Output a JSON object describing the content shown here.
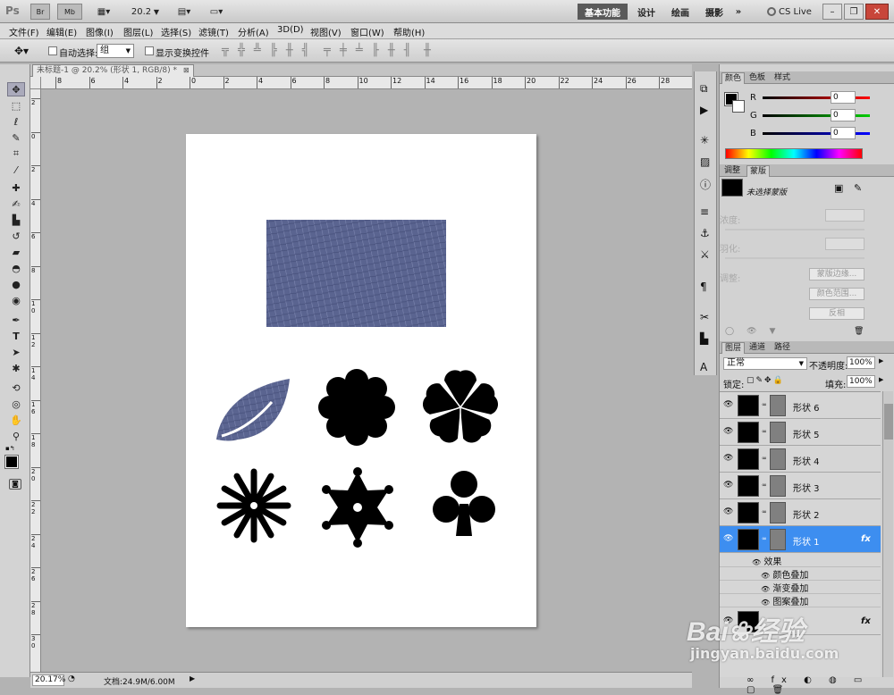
{
  "app": {
    "logo": "Ps",
    "zoom": "20.2",
    "workspace_active": "基本功能",
    "workspaces": [
      "设计",
      "绘画",
      "摄影"
    ],
    "cs_live": "CS Live"
  },
  "menu": [
    "文件(F)",
    "编辑(E)",
    "图像(I)",
    "图层(L)",
    "选择(S)",
    "滤镜(T)",
    "分析(A)",
    "3D(D)",
    "视图(V)",
    "窗口(W)",
    "帮助(H)"
  ],
  "options": {
    "auto_select_label": "自动选择:",
    "auto_select_value": "组",
    "transform_label": "显示变换控件"
  },
  "document": {
    "tab_title": "未标题-1 @ 20.2% (形状 1, RGB/8) *"
  },
  "ruler": {
    "h_labels": [
      "8",
      "6",
      "4",
      "2",
      "0",
      "2",
      "4",
      "6",
      "8",
      "10",
      "12",
      "14",
      "16",
      "18",
      "20",
      "22",
      "24",
      "26",
      "28"
    ],
    "v_labels": [
      "2",
      "0",
      "2",
      "4",
      "6",
      "8",
      "1\n0",
      "1\n2",
      "1\n4",
      "1\n6",
      "1\n8",
      "2\n0",
      "2\n2",
      "2\n4",
      "2\n6",
      "2\n8",
      "3\n0"
    ]
  },
  "status": {
    "zoom": "20.17%",
    "doc": "文档:24.9M/6.00M"
  },
  "color_panel": {
    "tabs": [
      "颜色",
      "色板",
      "样式"
    ],
    "r_label": "R",
    "g_label": "G",
    "b_label": "B",
    "r": "0",
    "g": "0",
    "b": "0"
  },
  "adjust_panel": {
    "tabs": [
      "调整",
      "蒙版"
    ],
    "no_mask": "未选择蒙版",
    "density": "浓度:",
    "feather": "羽化:",
    "adjust": "调整:",
    "edge_btn": "蒙版边缘...",
    "range_btn": "颜色范围...",
    "invert_btn": "反相"
  },
  "layers_panel": {
    "tabs": [
      "图层",
      "通道",
      "路径"
    ],
    "blend_mode": "正常",
    "opacity_label": "不透明度:",
    "opacity": "100%",
    "lock_label": "锁定:",
    "fill_label": "填充:",
    "fill": "100%",
    "layers": [
      "形状 6",
      "形状 5",
      "形状 4",
      "形状 3",
      "形状 2",
      "形状 1"
    ],
    "effects_label": "效果",
    "effects": [
      "颜色叠加",
      "渐变叠加",
      "图案叠加"
    ],
    "fx": "fx"
  },
  "watermark": {
    "brand": "Bai",
    "brand2": "经验",
    "url": "jingyan.baidu.com"
  },
  "colors": {
    "accent": "#3d8ef0",
    "fabric": "#5a6490"
  }
}
